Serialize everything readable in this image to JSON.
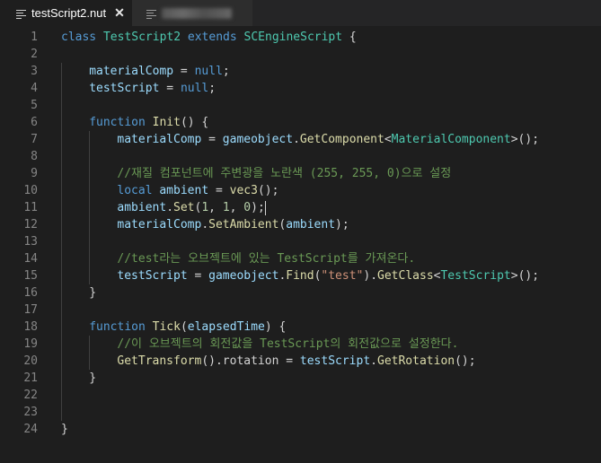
{
  "tabs": [
    {
      "label": "testScript2.nut",
      "active": true,
      "icon": "file-lines-icon",
      "close": "✕"
    },
    {
      "label": "",
      "active": false,
      "icon": "file-lines-icon",
      "blurred": true
    }
  ],
  "colors": {
    "background": "#1e1e1e",
    "tabbar": "#252526",
    "line_number": "#858585",
    "keyword": "#569cd6",
    "variable": "#9cdcfe",
    "function": "#dcdcaa",
    "type": "#4ec9b0",
    "number": "#b5cea8",
    "string": "#ce9178",
    "comment": "#6a9955",
    "text": "#d4d4d4"
  },
  "lines": [
    {
      "n": "1",
      "indent": 0,
      "tokens": [
        [
          "keyword",
          "class"
        ],
        [
          "plain",
          " "
        ],
        [
          "type",
          "TestScript2"
        ],
        [
          "plain",
          " "
        ],
        [
          "keyword",
          "extends"
        ],
        [
          "plain",
          " "
        ],
        [
          "type",
          "SCEngineScript"
        ],
        [
          "plain",
          " {"
        ]
      ]
    },
    {
      "n": "2",
      "indent": 0,
      "tokens": []
    },
    {
      "n": "3",
      "indent": 1,
      "tokens": [
        [
          "variable",
          "materialComp"
        ],
        [
          "plain",
          " = "
        ],
        [
          "keyword",
          "null"
        ],
        [
          "plain",
          ";"
        ]
      ]
    },
    {
      "n": "4",
      "indent": 1,
      "tokens": [
        [
          "variable",
          "testScript"
        ],
        [
          "plain",
          " = "
        ],
        [
          "keyword",
          "null"
        ],
        [
          "plain",
          ";"
        ]
      ]
    },
    {
      "n": "5",
      "indent": 1,
      "tokens": []
    },
    {
      "n": "6",
      "indent": 1,
      "tokens": [
        [
          "keyword",
          "function"
        ],
        [
          "plain",
          " "
        ],
        [
          "function",
          "Init"
        ],
        [
          "plain",
          "() {"
        ]
      ]
    },
    {
      "n": "7",
      "indent": 2,
      "tokens": [
        [
          "variable",
          "materialComp"
        ],
        [
          "plain",
          " = "
        ],
        [
          "variable",
          "gameobject"
        ],
        [
          "plain",
          "."
        ],
        [
          "function",
          "GetComponent"
        ],
        [
          "plain",
          "<"
        ],
        [
          "type",
          "MaterialComponent"
        ],
        [
          "plain",
          ">();"
        ]
      ]
    },
    {
      "n": "8",
      "indent": 2,
      "tokens": []
    },
    {
      "n": "9",
      "indent": 2,
      "tokens": [
        [
          "comment",
          "//재질 컴포넌트에 주변광을 노란색 (255, 255, 0)으로 설정"
        ]
      ]
    },
    {
      "n": "10",
      "indent": 2,
      "tokens": [
        [
          "keyword",
          "local"
        ],
        [
          "plain",
          " "
        ],
        [
          "variable",
          "ambient"
        ],
        [
          "plain",
          " = "
        ],
        [
          "function",
          "vec3"
        ],
        [
          "plain",
          "();"
        ]
      ]
    },
    {
      "n": "11",
      "indent": 2,
      "tokens": [
        [
          "variable",
          "ambient"
        ],
        [
          "plain",
          "."
        ],
        [
          "function",
          "Set"
        ],
        [
          "plain",
          "("
        ],
        [
          "number",
          "1"
        ],
        [
          "plain",
          ", "
        ],
        [
          "number",
          "1"
        ],
        [
          "plain",
          ", "
        ],
        [
          "number",
          "0"
        ],
        [
          "plain",
          ");"
        ]
      ],
      "cursor": true
    },
    {
      "n": "12",
      "indent": 2,
      "tokens": [
        [
          "variable",
          "materialComp"
        ],
        [
          "plain",
          "."
        ],
        [
          "function",
          "SetAmbient"
        ],
        [
          "plain",
          "("
        ],
        [
          "variable",
          "ambient"
        ],
        [
          "plain",
          ");"
        ]
      ]
    },
    {
      "n": "13",
      "indent": 2,
      "tokens": []
    },
    {
      "n": "14",
      "indent": 2,
      "tokens": [
        [
          "comment",
          "//test라는 오브젝트에 있는 TestScript를 가져온다."
        ]
      ]
    },
    {
      "n": "15",
      "indent": 2,
      "tokens": [
        [
          "variable",
          "testScript"
        ],
        [
          "plain",
          " = "
        ],
        [
          "variable",
          "gameobject"
        ],
        [
          "plain",
          "."
        ],
        [
          "function",
          "Find"
        ],
        [
          "plain",
          "("
        ],
        [
          "string",
          "\"test\""
        ],
        [
          "plain",
          ")."
        ],
        [
          "function",
          "GetClass"
        ],
        [
          "plain",
          "<"
        ],
        [
          "type",
          "TestScript"
        ],
        [
          "plain",
          ">();"
        ]
      ]
    },
    {
      "n": "16",
      "indent": 1,
      "tokens": [
        [
          "plain",
          "}"
        ]
      ]
    },
    {
      "n": "17",
      "indent": 1,
      "tokens": []
    },
    {
      "n": "18",
      "indent": 1,
      "tokens": [
        [
          "keyword",
          "function"
        ],
        [
          "plain",
          " "
        ],
        [
          "function",
          "Tick"
        ],
        [
          "plain",
          "("
        ],
        [
          "variable",
          "elapsedTime"
        ],
        [
          "plain",
          ") {"
        ]
      ]
    },
    {
      "n": "19",
      "indent": 2,
      "tokens": [
        [
          "comment",
          "//이 오브젝트의 회전값을 TestScript의 회전값으로 설정한다."
        ]
      ]
    },
    {
      "n": "20",
      "indent": 2,
      "tokens": [
        [
          "function",
          "GetTransform"
        ],
        [
          "plain",
          "().rotation = "
        ],
        [
          "variable",
          "testScript"
        ],
        [
          "plain",
          "."
        ],
        [
          "function",
          "GetRotation"
        ],
        [
          "plain",
          "();"
        ]
      ]
    },
    {
      "n": "21",
      "indent": 1,
      "tokens": [
        [
          "plain",
          "}"
        ]
      ]
    },
    {
      "n": "22",
      "indent": 1,
      "tokens": []
    },
    {
      "n": "23",
      "indent": 1,
      "tokens": []
    },
    {
      "n": "24",
      "indent": 0,
      "tokens": [
        [
          "plain",
          "}"
        ]
      ]
    }
  ]
}
